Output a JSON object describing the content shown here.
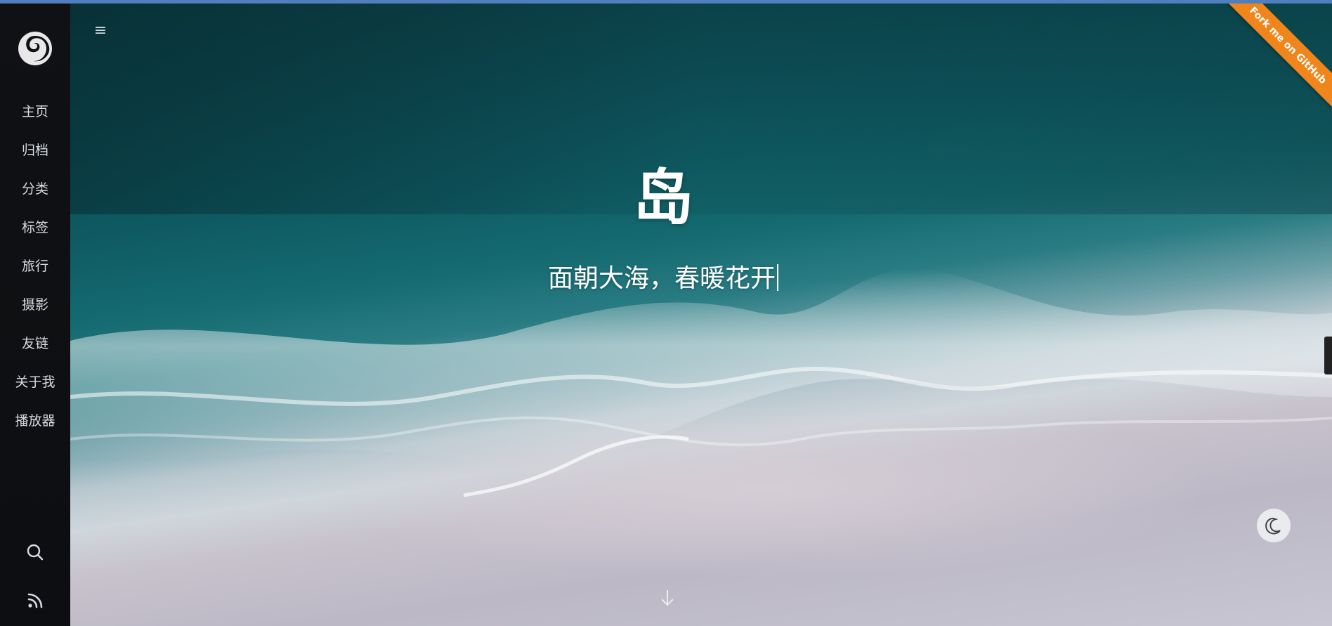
{
  "sidebar": {
    "logo_icon": "swirl-logo-icon",
    "items": [
      {
        "label": "主页"
      },
      {
        "label": "归档"
      },
      {
        "label": "分类"
      },
      {
        "label": "标签"
      },
      {
        "label": "旅行"
      },
      {
        "label": "摄影"
      },
      {
        "label": "友链"
      },
      {
        "label": "关于我"
      },
      {
        "label": "播放器"
      }
    ],
    "bottom_icons": [
      "search-icon",
      "rss-icon"
    ]
  },
  "header": {
    "menu_icon": "hamburger-menu-icon",
    "menu_glyph": "≡"
  },
  "hero": {
    "title": "岛",
    "subtitle": "面朝大海，春暖花开"
  },
  "ribbon": {
    "label": "Fork me on GitHub",
    "color": "#f0861b"
  },
  "theme_toggle": {
    "icon": "moon-icon"
  },
  "scroll_down": {
    "icon": "arrow-down-icon"
  },
  "colors": {
    "accent_top": "#4f7fbf",
    "sidebar_bg": "#0f1114"
  }
}
